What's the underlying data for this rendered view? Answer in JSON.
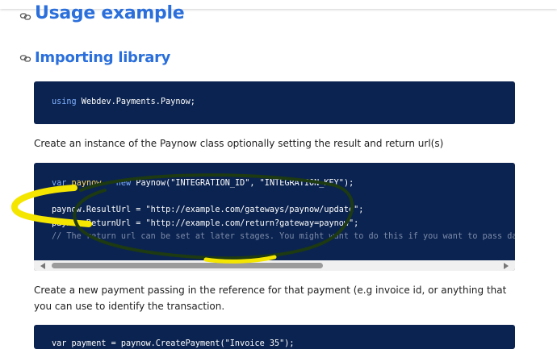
{
  "headings": {
    "usage": "Usage example",
    "importing": "Importing library"
  },
  "icons": {
    "heading_link": "link-icon"
  },
  "code1": {
    "line1": {
      "keyword": "using",
      "rest": " Webdev.Payments.Paynow;"
    }
  },
  "paragraphs": {
    "instance": "Create an instance of the Paynow class optionally setting the result and return url(s)",
    "payment": "Create a new payment passing in the reference for that payment (e.g invoice id, or anything that you can use to identify the transaction."
  },
  "code2": {
    "line1": {
      "kw": "var",
      "var": "paynow",
      "op": " = ",
      "kw2": "new",
      "call": " Paynow(",
      "s1": "\"INTEGRATION_ID\"",
      "sep": ", ",
      "s2": "\"INTEGRATION_KEY\"",
      "end": ");"
    },
    "line2": {
      "lhs": "paynow.ResultUrl = ",
      "str": "\"http://example.com/gateways/paynow/update\"",
      "end": ";"
    },
    "line3": {
      "lhs": "paynow.ReturnUrl = ",
      "str": "\"http://example.com/return?gateway=paynow\"",
      "end": ";"
    },
    "line4": "// The return url can be set at later stages. You might want to do this if you want to pass data"
  },
  "code3": {
    "line1": "var payment = paynow.CreatePayment(\"Invoice 35\");"
  },
  "colors": {
    "heading": "#2a6fdb",
    "code_bg": "#0b2350",
    "highlight_yellow": "#f5e600",
    "circle_green": "#1d3a12"
  }
}
